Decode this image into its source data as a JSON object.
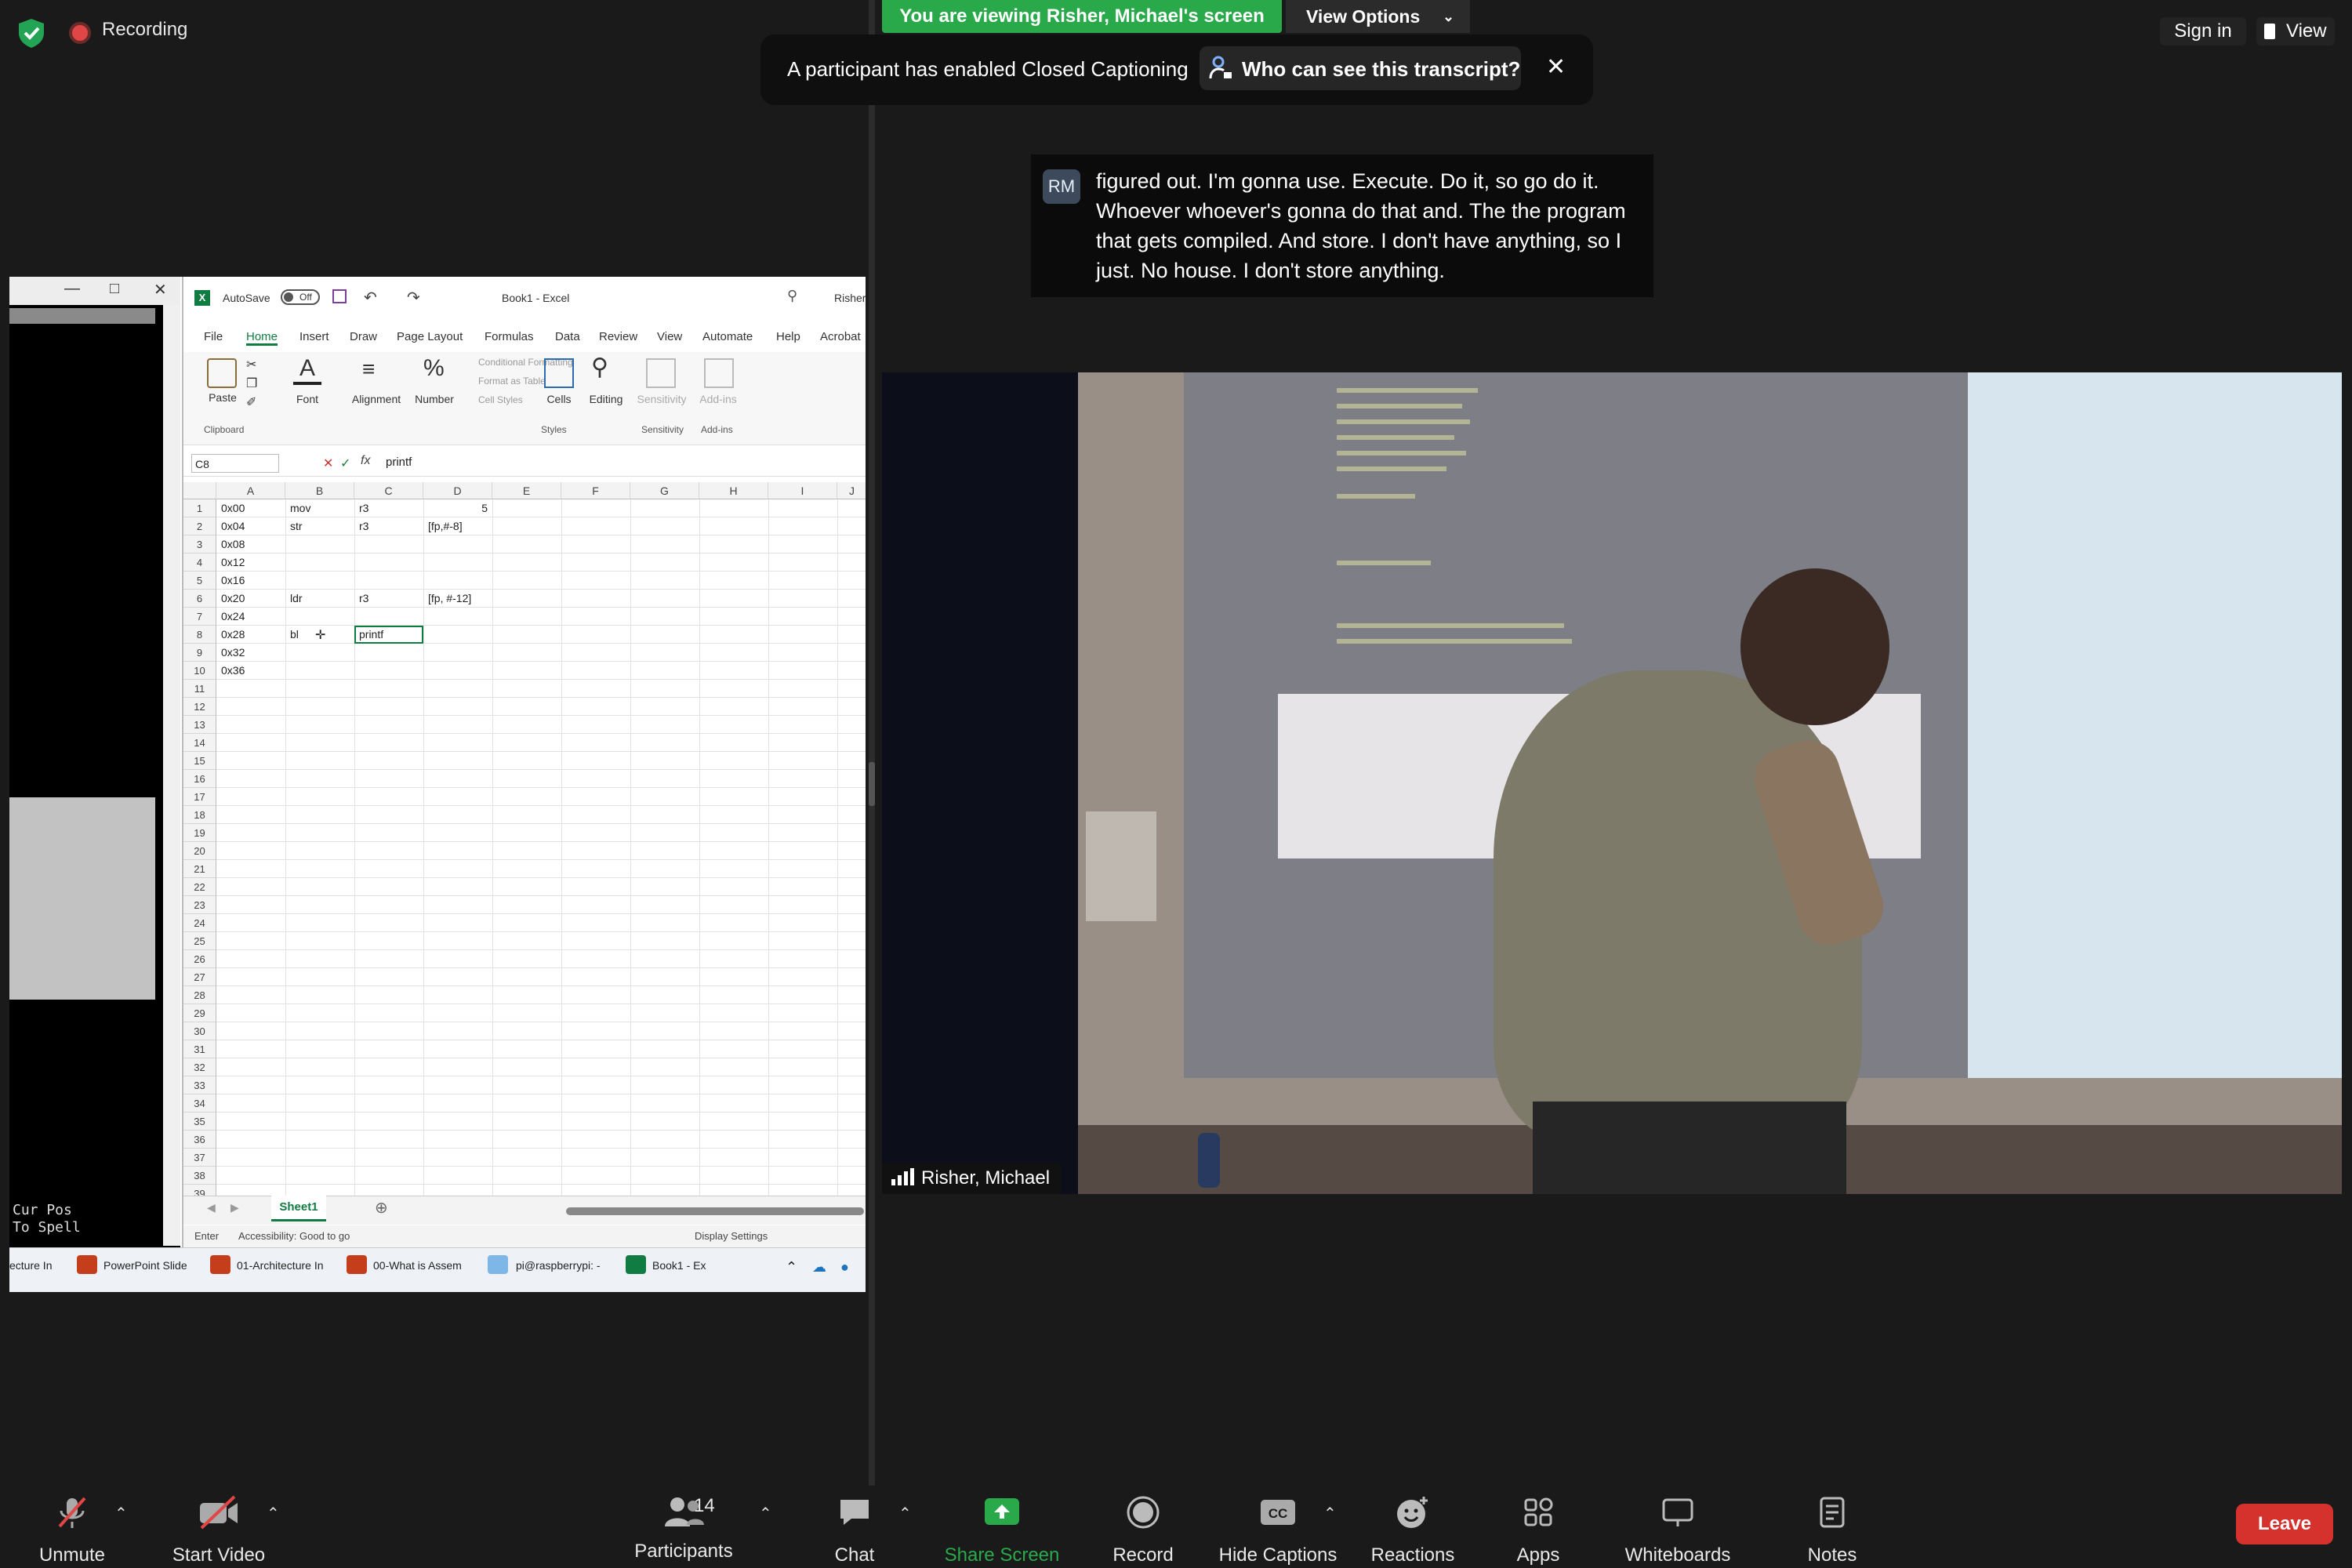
{
  "top_bar": {
    "recording_label": "Recording",
    "viewing_banner": "You are viewing Risher, Michael's screen",
    "view_options_label": "View Options",
    "sign_in_label": "Sign in",
    "view_label": "View"
  },
  "cc_notice": {
    "message": "A participant has enabled Closed Captioning",
    "who_can_see": "Who can see this transcript?"
  },
  "caption": {
    "initials": "RM",
    "text": "figured out. I'm gonna use. Execute. Do it, so go do it. Whoever whoever's gonna do that and. The the program that gets compiled. And store. I don't have anything, so I just. No house. I don't store anything."
  },
  "video": {
    "participant_name": "Risher, Michael"
  },
  "terminal": {
    "status_text": "Cur Pos\nTo Spell"
  },
  "excel": {
    "autosave_label": "AutoSave",
    "autosave_state": "Off",
    "doc_title": "Book1 - Excel",
    "user_name": "Risher,",
    "menu_tabs": [
      "File",
      "Home",
      "Insert",
      "Draw",
      "Page Layout",
      "Formulas",
      "Data",
      "Review",
      "View",
      "Automate",
      "Help",
      "Acrobat"
    ],
    "ribbon": {
      "paste": "Paste",
      "font": "Font",
      "alignment": "Alignment",
      "number": "Number",
      "conditional_formatting": "Conditional Formatting",
      "format_as_table": "Format as Table",
      "cell_styles": "Cell Styles",
      "cells": "Cells",
      "editing": "Editing",
      "sensitivity": "Sensitivity",
      "add_ins": "Add-ins",
      "group_clipboard": "Clipboard",
      "group_styles": "Styles",
      "group_sensitivity": "Sensitivity",
      "group_add_ins": "Add-ins"
    },
    "name_box": "C8",
    "formula": "printf",
    "columns": [
      "A",
      "B",
      "C",
      "D",
      "E",
      "F",
      "G",
      "H",
      "I",
      "J"
    ],
    "rows": [
      {
        "n": "1",
        "A": "0x00",
        "B": "mov",
        "C": "r3",
        "D": "5"
      },
      {
        "n": "2",
        "A": "0x04",
        "B": "str",
        "C": "r3",
        "D": "[fp,#-8]"
      },
      {
        "n": "3",
        "A": "0x08",
        "B": "",
        "C": "",
        "D": ""
      },
      {
        "n": "4",
        "A": "0x12",
        "B": "",
        "C": "",
        "D": ""
      },
      {
        "n": "5",
        "A": "0x16",
        "B": "",
        "C": "",
        "D": ""
      },
      {
        "n": "6",
        "A": "0x20",
        "B": "ldr",
        "C": "r3",
        "D": "[fp, #-12]"
      },
      {
        "n": "7",
        "A": "0x24",
        "B": "",
        "C": "",
        "D": ""
      },
      {
        "n": "8",
        "A": "0x28",
        "B": "bl",
        "C": "printf",
        "D": ""
      },
      {
        "n": "9",
        "A": "0x32",
        "B": "",
        "C": "",
        "D": ""
      },
      {
        "n": "10",
        "A": "0x36",
        "B": "",
        "C": "",
        "D": ""
      }
    ],
    "row_numbers_extra": [
      "11",
      "12",
      "13",
      "14",
      "15",
      "16",
      "17",
      "18",
      "19",
      "20",
      "21",
      "22",
      "23",
      "24",
      "25",
      "26",
      "27",
      "28",
      "29",
      "30",
      "31",
      "32",
      "33",
      "34",
      "35",
      "36",
      "37",
      "38",
      "39"
    ],
    "sheet_tab": "Sheet1",
    "status_mode": "Enter",
    "accessibility": "Accessibility: Good to go",
    "display_settings": "Display Settings"
  },
  "taskbar": {
    "items": [
      "ecture In",
      "PowerPoint Slide",
      "01-Architecture In",
      "00-What is Assem",
      "pi@raspberrypi: -",
      "Book1 - Ex"
    ]
  },
  "toolbar": {
    "unmute": "Unmute",
    "start_video": "Start Video",
    "participants": "Participants",
    "participant_count": "14",
    "chat": "Chat",
    "share_screen": "Share Screen",
    "record": "Record",
    "hide_captions": "Hide Captions",
    "reactions": "Reactions",
    "apps": "Apps",
    "whiteboards": "Whiteboards",
    "notes": "Notes",
    "leave": "Leave"
  },
  "colors": {
    "zoom_green": "#2aa94b",
    "leave_red": "#d6322d",
    "excel_green": "#107c41",
    "background": "#1a1a1a"
  }
}
